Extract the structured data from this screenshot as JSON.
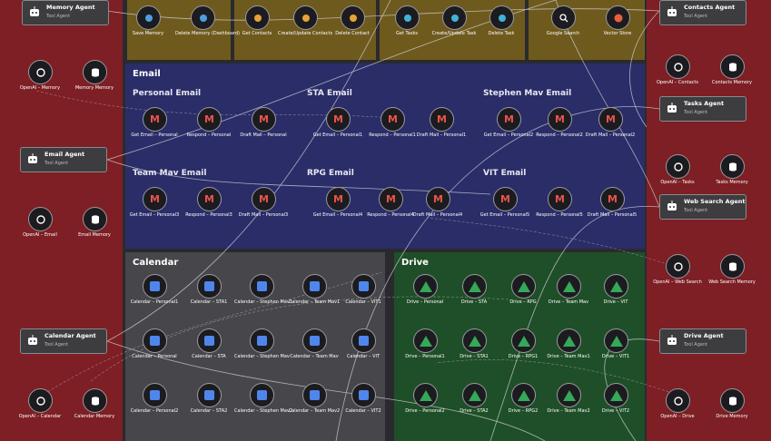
{
  "sections": {
    "email": "Email",
    "calendar": "Calendar",
    "drive": "Drive"
  },
  "email_groups": {
    "personal": "Personal Email",
    "sta": "STA Email",
    "stephen": "Stephen Mav Email",
    "team": "Team Mav Email",
    "rpg": "RPG Email",
    "vit": "VIT Email"
  },
  "agents": {
    "memory": {
      "title": "Memory Agent",
      "sub": "Tool Agent"
    },
    "email": {
      "title": "Email Agent",
      "sub": "Tool Agent"
    },
    "calendar": {
      "title": "Calendar Agent",
      "sub": "Tool Agent"
    },
    "contacts": {
      "title": "Contacts Agent",
      "sub": "Tool Agent"
    },
    "tasks": {
      "title": "Tasks Agent",
      "sub": "Tool Agent"
    },
    "websearch": {
      "title": "Web Search Agent",
      "sub": "Tool Agent"
    },
    "drive": {
      "title": "Drive Agent",
      "sub": "Tool Agent"
    }
  },
  "side_nodes": {
    "openai_memory": "OpenAI – Memory",
    "memory_memory": "Memory Memory",
    "openai_email": "OpenAI – Email",
    "email_memory": "Email Memory",
    "openai_calendar": "OpenAI – Calendar",
    "calendar_memory": "Calendar Memory",
    "openai_contacts": "OpenAI – Contacts",
    "contacts_memory": "Contacts Memory",
    "openai_tasks": "OpenAI – Tasks",
    "tasks_memory": "Tasks Memory",
    "openai_websearch": "OpenAI – Web Search",
    "websearch_memory": "Web Search Memory",
    "openai_drive": "OpenAI – Drive",
    "drive_memory": "Drive Memory"
  },
  "top_nodes": [
    "Save Memory",
    "Delete Memory (Dashboard)",
    "Get Contacts",
    "Create/Update Contacts",
    "Delete Contact",
    "Get Tasks",
    "Create/Update Task",
    "Delete Task",
    "Google Search",
    "Vector Store"
  ],
  "email_rows": {
    "personal": [
      "Get Email – Personal",
      "Respond – Personal",
      "Draft Mail – Personal"
    ],
    "sta": [
      "Get Email – Personal1",
      "Respond – Personal1",
      "Draft Mail – Personal1"
    ],
    "stephen": [
      "Get Email – Personal2",
      "Respond – Personal2",
      "Draft Mail – Personal2"
    ],
    "team": [
      "Get Email – Personal3",
      "Respond – Personal3",
      "Draft Mail – Personal3"
    ],
    "rpg": [
      "Get Email – Personal4",
      "Respond – Personal4",
      "Draft Mail – Personal4"
    ],
    "vit": [
      "Get Email – Personal5",
      "Respond – Personal5",
      "Draft Mail – Personal5"
    ]
  },
  "calendar_rows": [
    [
      "Calendar – Personal1",
      "Calendar – STA1",
      "Calendar – Stephen Mav1",
      "Calendar – Team Mav1",
      "Calendar – VIT1"
    ],
    [
      "Calendar – Personal",
      "Calendar – STA",
      "Calendar – Stephen Mav",
      "Calendar – Team Mav",
      "Calendar – VIT"
    ],
    [
      "Calendar – Personal2",
      "Calendar – STA2",
      "Calendar – Stephen Mav2",
      "Calendar – Team Mav2",
      "Calendar – VIT2"
    ]
  ],
  "drive_rows": [
    [
      "Drive – Personal",
      "Drive – STA",
      "Drive – RPG",
      "Drive – Team Mav",
      "Drive – VIT"
    ],
    [
      "Drive – Personal1",
      "Drive – STA1",
      "Drive – RPG1",
      "Drive – Team Mav1",
      "Drive – VIT1"
    ],
    [
      "Drive – Personal2",
      "Drive – STA2",
      "Drive – RPG2",
      "Drive – Team Mav2",
      "Drive – VIT2"
    ]
  ]
}
